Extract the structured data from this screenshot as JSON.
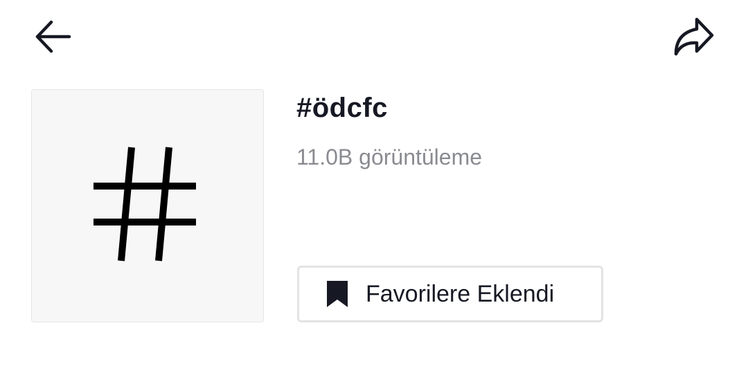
{
  "header": {
    "back_icon": "back-arrow-icon",
    "share_icon": "share-icon"
  },
  "hashtag": {
    "cover_icon": "hashtag-icon",
    "title": "#ödcfc",
    "views": "11.0B görüntüleme"
  },
  "favorite_button": {
    "icon": "bookmark-filled-icon",
    "label": "Favorilere Eklendi"
  },
  "colors": {
    "text_primary": "#161823",
    "text_secondary": "#8a8b91",
    "thumb_bg": "#f7f7f7",
    "button_border": "#e3e3e4"
  }
}
